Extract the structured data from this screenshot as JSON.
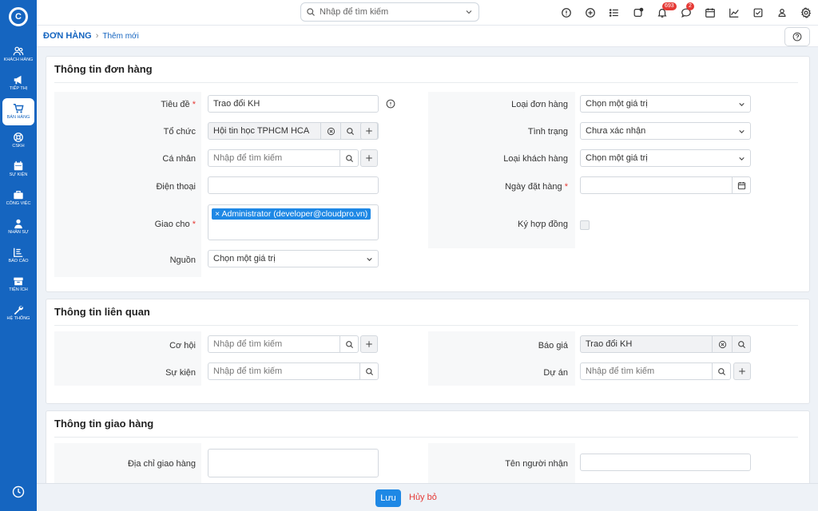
{
  "sidebar": {
    "logo": "C",
    "items": [
      {
        "label": "KHÁCH HÀNG",
        "icon": "users-icon"
      },
      {
        "label": "TIẾP THỊ",
        "icon": "megaphone-icon"
      },
      {
        "label": "BÁN HÀNG",
        "icon": "cart-icon",
        "active": true
      },
      {
        "label": "CSKH",
        "icon": "lifebuoy-icon"
      },
      {
        "label": "SỰ KIỆN",
        "icon": "calendar-icon"
      },
      {
        "label": "CÔNG VIỆC",
        "icon": "briefcase-icon"
      },
      {
        "label": "NHÂN SỰ",
        "icon": "person-icon"
      },
      {
        "label": "BÁO CÁO",
        "icon": "report-icon"
      },
      {
        "label": "TIỆN ÍCH",
        "icon": "box-icon"
      },
      {
        "label": "HỆ THỐNG",
        "icon": "wrench-icon"
      }
    ]
  },
  "topbar": {
    "search_placeholder": "Nhập để tìm kiếm",
    "notifications_count": "693",
    "messages_count": "2"
  },
  "breadcrumb": {
    "module": "ĐƠN HÀNG",
    "page": "Thêm mới"
  },
  "order_info": {
    "title": "Thông tin đơn hàng",
    "subject_label": "Tiêu đề",
    "subject_value": "Trao đổi KH",
    "org_label": "Tổ chức",
    "org_value": "Hội tin học TPHCM HCA",
    "person_label": "Cá nhân",
    "person_placeholder": "Nhập để tìm kiếm",
    "phone_label": "Điện thoại",
    "assignee_label": "Giao cho",
    "assignee_tag": "Administrator (developer@cloudpro.vn)",
    "source_label": "Nguồn",
    "source_value": "Chọn một giá trị",
    "order_type_label": "Loại đơn hàng",
    "order_type_value": "Chọn một giá trị",
    "status_label": "Tình trạng",
    "status_value": "Chưa xác nhận",
    "customer_type_label": "Loại khách hàng",
    "customer_type_value": "Chọn một giá trị",
    "order_date_label": "Ngày đặt hàng",
    "contract_label": "Ký hợp đồng"
  },
  "related_info": {
    "title": "Thông tin liên quan",
    "opportunity_label": "Cơ hội",
    "opportunity_placeholder": "Nhập để tìm kiếm",
    "event_label": "Sự kiện",
    "event_placeholder": "Nhập để tìm kiếm",
    "quote_label": "Báo giá",
    "quote_value": "Trao đổi KH",
    "project_label": "Dự án",
    "project_placeholder": "Nhập để tìm kiếm"
  },
  "delivery_info": {
    "title": "Thông tin giao hàng",
    "address_label": "Địa chỉ giao hàng",
    "recipient_label": "Tên người nhận"
  },
  "footer": {
    "save_label": "Lưu",
    "cancel_label": "Hủy bỏ"
  }
}
